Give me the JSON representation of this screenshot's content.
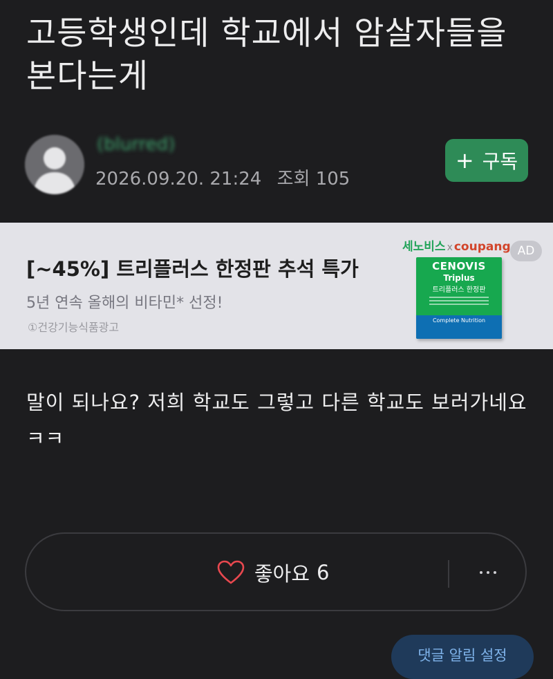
{
  "post": {
    "title": "고등학생인데 학교에서 암살자들을 본다는게",
    "body": "말이 되나요? 저희 학교도 그렇고 다른 학교도 보러가네요 ㅋㅋ"
  },
  "author": {
    "name": "(blurred)",
    "date": "2026.09.20. 21:24",
    "views_label": "조회",
    "views": "105"
  },
  "subscribe": {
    "plus": "+",
    "label": "구독"
  },
  "ad": {
    "headline": "[~45%] 트리플러스 한정판 추석 특가",
    "subtext": "5년 연속 올해의 비타민* 선정!",
    "disclaimer": "①건강기능식품광고",
    "brand_left": "세노비스",
    "brand_x": "x",
    "brand_right": "coupang",
    "badge": "AD",
    "product_brand": "CENOVIS",
    "product_name": "Triplus",
    "product_kr": "트리플러스 한정판",
    "product_footer": "Complete Nutrition"
  },
  "actions": {
    "like_label": "좋아요",
    "like_count": "6"
  },
  "comment_alert": {
    "label": "댓글 알림 설정"
  },
  "colors": {
    "background": "#1d1d1f",
    "accent_green": "#2e8b57",
    "author_green": "#3fa36d",
    "ad_background": "#e3e3e8",
    "alert_blue": "#7fb3ea"
  },
  "icons": {
    "like": "heart-outline-icon",
    "more": "more-horizontal-icon",
    "avatar": "default-user-avatar-icon"
  }
}
